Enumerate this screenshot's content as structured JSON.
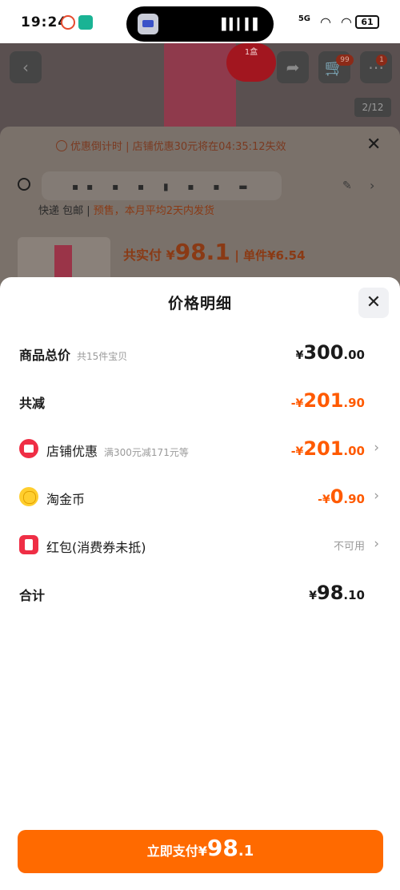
{
  "status_bar": {
    "time": "19:24",
    "signal": "5G",
    "battery": "61"
  },
  "background": {
    "product_badge": "1盒",
    "cart_count": "99",
    "page_indicator": "2/12",
    "countdown": "优惠倒计时 | 店铺优惠30元将在04:35:12失效",
    "shipping_prefix": "快递 包邮 | ",
    "shipping_note": "预售，本月平均2天内发货",
    "total_label": "共实付 ¥",
    "total_value": "98.1",
    "unit_price": "| 单件¥6.54"
  },
  "modal": {
    "title": "价格明细",
    "rows": [
      {
        "label": "商品总价",
        "sub": "共15件宝贝",
        "yen": "¥",
        "int": "300",
        "dec": ".00"
      },
      {
        "label": "共减",
        "yen": "-¥",
        "int": "201",
        "dec": ".90"
      },
      {
        "label": "店铺优惠",
        "sub": "满300元减171元等",
        "yen": "-¥",
        "int": "201",
        "dec": ".00"
      },
      {
        "label": "淘金币",
        "yen": "-¥",
        "int": "0",
        "dec": ".90"
      },
      {
        "label": "红包(消费券未抵)",
        "value": "不可用"
      },
      {
        "label": "合计",
        "yen": "¥",
        "int": "98",
        "dec": ".10"
      }
    ]
  },
  "pay_button": {
    "label": "立即支付",
    "yen": "¥",
    "int": "98",
    "dec": ".1"
  },
  "colors": {
    "accent": "#ff6a00",
    "discount": "#ff5a00"
  }
}
